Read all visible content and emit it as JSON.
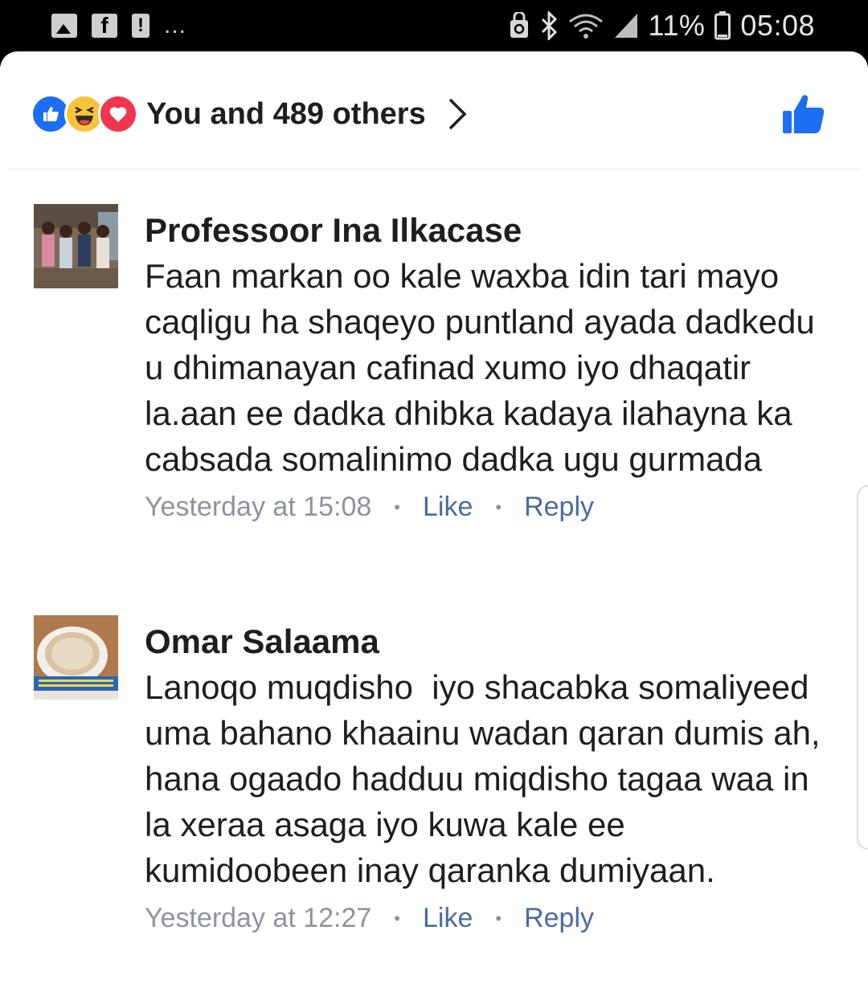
{
  "status_bar": {
    "icons_left": [
      "image-icon",
      "facebook-icon",
      "alert-icon"
    ],
    "overflow": "...",
    "icons_right": [
      "recycle-lock-icon",
      "bluetooth-icon",
      "wifi-icon",
      "signal-icon"
    ],
    "battery": "11%",
    "time": "05:08"
  },
  "reactions": {
    "icons": [
      "like-reaction-icon",
      "haha-reaction-icon",
      "love-reaction-icon"
    ],
    "summary": "You and 489 others"
  },
  "comments": [
    {
      "author": "Professoor Ina Ilkacase",
      "text": "Faan markan oo kale waxba idin tari mayo caqligu ha shaqeyo puntland ayada dadkedu u dhimanayan cafinad xumo iyo dhaqatir la.aan ee dadka dhibka kadaya ilahayna ka cabsada somalinimo dadka ugu gurmada",
      "time": "Yesterday at 15:08",
      "like": "Like",
      "reply": "Reply"
    },
    {
      "author": "Omar Salaama",
      "text": "Lanoqo muqdisho  iyo shacabka somaliyeed  uma bahano khaainu wadan qaran dumis ah, hana ogaado hadduu miqdisho tagaa waa in la xeraa asaga iyo kuwa kale ee kumidoobeen inay qaranka dumiyaan.",
      "time": "Yesterday at 12:27",
      "like": "Like",
      "reply": "Reply"
    }
  ],
  "colors": {
    "like_blue": "#1c6ff2",
    "link": "#4b6aa0",
    "meta_gray": "#8d949e",
    "text": "#1c1e21"
  }
}
